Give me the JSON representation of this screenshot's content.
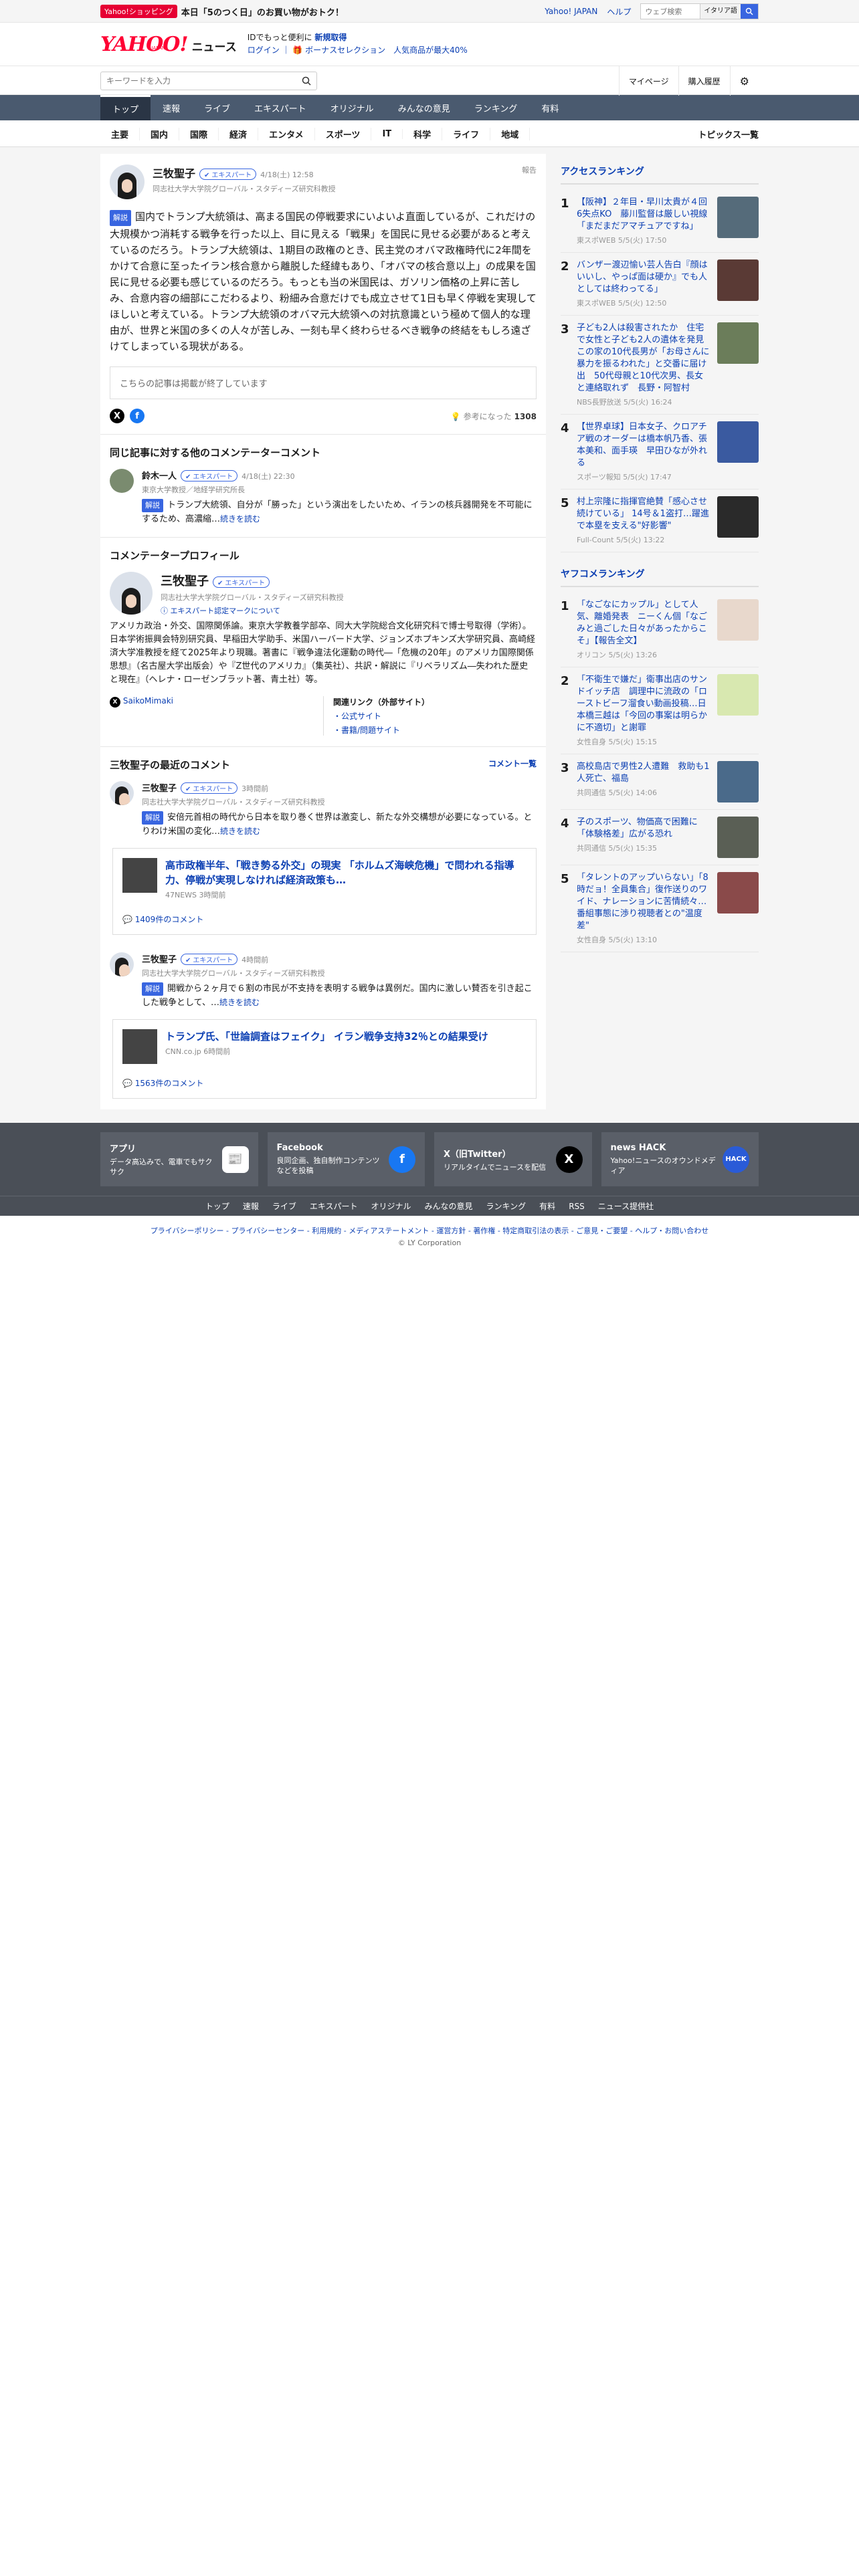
{
  "topbar": {
    "badge": "Yahoo!ショッピング",
    "promo": "本日「5のつく日」のお買い物がおトク！",
    "links": [
      "Yahoo! JAPAN",
      "ヘルプ"
    ],
    "search_placeholder": "ウェブ検索",
    "box": "イタリア語"
  },
  "header": {
    "logo": "YAHOO!",
    "logo_sub": "JAPAN",
    "section": "ニュース",
    "msg1": "IDでもっと便利に",
    "msg1b": "新規取得",
    "msg2": "ログイン ｜ 🎁 ボーナスセレクション　人気商品が最大40%"
  },
  "search": {
    "placeholder": "キーワードを入力",
    "mypage": "マイページ",
    "history": "購入履歴"
  },
  "nav": [
    "トップ",
    "速報",
    "ライブ",
    "エキスパート",
    "オリジナル",
    "みんなの意見",
    "ランキング",
    "有料"
  ],
  "subnav": [
    "主要",
    "国内",
    "国際",
    "経済",
    "エンタメ",
    "スポーツ",
    "IT",
    "科学",
    "ライフ",
    "地域"
  ],
  "subnav_last": "トピックス一覧",
  "comment": {
    "name": "三牧聖子",
    "badge": "エキスパート",
    "date": "4/18(土) 12:58",
    "aff": "同志社大学大学院グローバル・スタディーズ研究科教授",
    "report": "報告",
    "tag": "解説",
    "text": "国内でトランプ大統領は、高まる国民の停戦要求にいよいよ直面しているが、これだけの大規模かつ消耗する戦争を行った以上、目に見える「戦果」を国民に見せる必要があると考えているのだろう。トランプ大統領は、1期目の政権のとき、民主党のオバマ政権時代に2年間をかけて合意に至ったイラン核合意から離脱した経緯もあり、「オバマの核合意以上」の成果を国民に見せる必要も感じているのだろう。もっとも当の米国民は、ガソリン価格の上昇に苦しみ、合意内容の細部にこだわるより、粉細み合意だけでも成立させて1日も早く停戦を実現してほしいと考えている。トランプ大統領のオバマ元大統領への対抗意識という極めて個人的な理由が、世界と米国の多くの人々が苦しみ、一刻も早く終わらせるべき戦争の終結をもしろ遠ざけてしまっている現状がある。",
    "closed": "こちらの記事は掲載が終了しています",
    "helpful": "参考になった",
    "helpful_count": "1308"
  },
  "others": {
    "title": "同じ記事に対する他のコメンテーターコメント",
    "name": "鈴木一人",
    "badge": "エキスパート",
    "date": "4/18(土) 22:30",
    "aff": "東京大学教授／地経学研究所長",
    "tag": "解説",
    "text": "トランプ大統領、自分が「勝った」という演出をしたいため、イランの核兵器開発を不可能にするため、高濃縮…",
    "more": "続きを読む"
  },
  "profile": {
    "title": "コメンテータープロフィール",
    "name": "三牧聖子",
    "badge": "エキスパート",
    "aff": "同志社大学大学院グローバル・スタディーズ研究科教授",
    "mark": "エキスパート認定マークについて",
    "bio": "アメリカ政治・外交、国際関係論。東京大学教養学部卒、同大大学院総合文化研究科で博士号取得（学術）。日本学術振興会特別研究員、早稲田大学助手、米国ハーバード大学、ジョンズホプキンズ大学研究員、高崎経済大学准教授を経て2025年より現職。著書に『戦争違法化運動の時代―「危機の20年」のアメリカ国際関係思想』（名古屋大学出版会）や『Z世代のアメリカ』（集英社）、共訳・解説に『リベラリズム―失われた歴史と現在』（ヘレナ・ローゼンブラット著、青土社）等。",
    "twitter": "SaikoMimaki",
    "rel_title": "関連リンク（外部サイト）",
    "rel1": "公式サイト",
    "rel2": "書籍/問題サイト"
  },
  "recent": {
    "title": "三牧聖子の最近のコメント",
    "more": "コメント一覧",
    "items": [
      {
        "name": "三牧聖子",
        "badge": "エキスパート",
        "date": "3時間前",
        "aff": "同志社大学大学院グローバル・スタディーズ研究科教授",
        "tag": "解説",
        "text": "安倍元首相の時代から日本を取り巻く世界は激変し、新たな外交構想が必要になっている。とりわけ米国の変化…",
        "more": "続きを読む",
        "card_title": "高市政権半年、「戦き勢る外交」の現実 「ホルムズ海峡危機」で問われる指導力、停戦が実現しなければ経済政策も…",
        "card_meta": "47NEWS 3時間前",
        "comments": "1409件のコメント"
      },
      {
        "name": "三牧聖子",
        "badge": "エキスパート",
        "date": "4時間前",
        "aff": "同志社大学大学院グローバル・スタディーズ研究科教授",
        "tag": "解説",
        "text": "開戦から２ヶ月で６割の市民が不支持を表明する戦争は異例だ。国内に激しい賛否を引き起こした戦争として、…",
        "more": "続きを読む",
        "card_title": "トランプ氏、「世論調査はフェイク」 イラン戦争支持32％との結果受け",
        "card_meta": "CNN.co.jp 6時間前",
        "comments": "1563件のコメント"
      }
    ]
  },
  "access": {
    "title": "アクセスランキング",
    "items": [
      {
        "rank": "1",
        "title": "【阪神】２年目・早川太貴が４回6失点KO　藤川監督は厳しい視線「まだまだアマチュアですね」",
        "src": "東スポWEB 5/5(火) 17:50"
      },
      {
        "rank": "2",
        "title": "バンザー渡辺愉い芸人告白『顔はいいし、やっぱ面は硬か』でも人としては終わってる」",
        "src": "東スポWEB 5/5(火) 12:50"
      },
      {
        "rank": "3",
        "title": "子ども2人は殺害されたか　住宅で女性と子ども2人の遺体を発見　この家の10代長男が「お母さんに暴力を振るわれた」と交番に届け出　50代母親と10代次男、長女と連絡取れず　長野・阿智村",
        "src": "NBS長野放送 5/5(火) 16:24"
      },
      {
        "rank": "4",
        "title": "【世界卓球】日本女子、クロアチア戦のオーダーは橋本帆乃香、張本美和、面手瑛　早田ひなが外れる",
        "src": "スポーツ報知 5/5(火) 17:47"
      },
      {
        "rank": "5",
        "title": "村上宗隆に指揮官絶賛「感心させ続けている」 14号＆1盗打…躍進で本塁を支える\"好影響\"",
        "src": "Full-Count 5/5(火) 13:22"
      }
    ]
  },
  "yafuko": {
    "title": "ヤフコメランキング",
    "items": [
      {
        "rank": "1",
        "title": "「なごなにカップル」として人気、離婚発表　ニーくん個「なごみと過ごした日々があったからこそ」【報告全文】",
        "src": "オリコン 5/5(火) 13:26"
      },
      {
        "rank": "2",
        "title": "「不衛生で嫌だ」衛事出店のサンドイッチ店　調理中に流政の「ローストビーフ溜食い動画投稿…日本橋三越は「今回の事案は明らかに不適切」と謝罪",
        "src": "女性自身 5/5(火) 15:15"
      },
      {
        "rank": "3",
        "title": "高校島店で男性2人遭難　救助も1人死亡、福島",
        "src": "共同通信 5/5(火) 14:06"
      },
      {
        "rank": "4",
        "title": "子のスポーツ、物価高で困難に「体験格差」広がる恐れ",
        "src": "共同通信 5/5(火) 15:35"
      },
      {
        "rank": "5",
        "title": "「タレントのアップいらない」「8時だョ！全員集合」復作送りのワイド、ナレーションに苦情続々…番組事態に渉り視聴者との\"温度差\"",
        "src": "女性自身 5/5(火) 13:10"
      }
    ]
  },
  "footer": {
    "cards": [
      {
        "t": "アプリ",
        "d": "データ高込みで、電車でもサクサク",
        "logo": "📰"
      },
      {
        "t": "Facebook",
        "d": "良同企画、独自制作コンテンツなどを投稿",
        "logo": "f"
      },
      {
        "t": "X（旧Twitter）",
        "d": "リアルタイムでニュースを配信",
        "logo": "X"
      },
      {
        "t": "news HACK",
        "d": "Yahoo!ニュースのオウンドメディア",
        "logo": "HACK"
      }
    ],
    "links": [
      "トップ",
      "速報",
      "ライブ",
      "エキスパート",
      "オリジナル",
      "みんなの意見",
      "ランキング",
      "有料",
      "RSS",
      "ニュース提供社"
    ],
    "legal": "プライバシーポリシー - プライバシーセンター - 利用規約 - メディアステートメント - 運営方針 - 著作権 - 特定商取引法の表示 - ご意見・ご要望 - ヘルプ・お問い合わせ",
    "copy": "© LY Corporation"
  }
}
